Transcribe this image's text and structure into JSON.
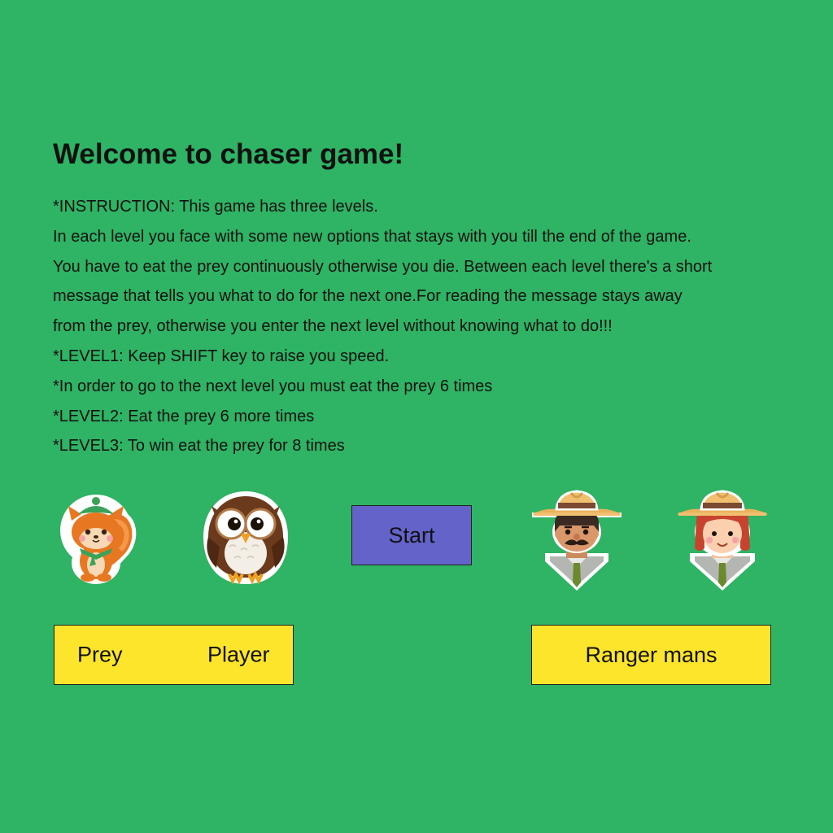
{
  "title": "Welcome to chaser game!",
  "instructions": [
    "*INSTRUCTION: This game has three levels.",
    "In each level you face with some new options that stays with you till the end of the game.",
    "You have to eat the prey continuously otherwise you die. Between each level there's a short",
    "message that tells you what to do for the next one.For reading the message stays away",
    "from the prey, otherwise you enter the next level without knowing what to do!!!",
    "*LEVEL1: Keep SHIFT key to raise you speed.",
    "*In order to go to the next level you must eat the prey 6 times",
    "*LEVEL2: Eat the prey 6 more times",
    "*LEVEL3: To win eat the prey for 8 times"
  ],
  "start_label": "Start",
  "labels": {
    "prey": "Prey",
    "player": "Player",
    "rangers": "Ranger mans"
  },
  "sprites": [
    "squirrel-sprite",
    "owl-sprite",
    "ranger-man-sprite",
    "ranger-woman-sprite"
  ],
  "colors": {
    "background": "#2fb364",
    "start_button": "#6463c9",
    "label_box": "#fde52b"
  }
}
